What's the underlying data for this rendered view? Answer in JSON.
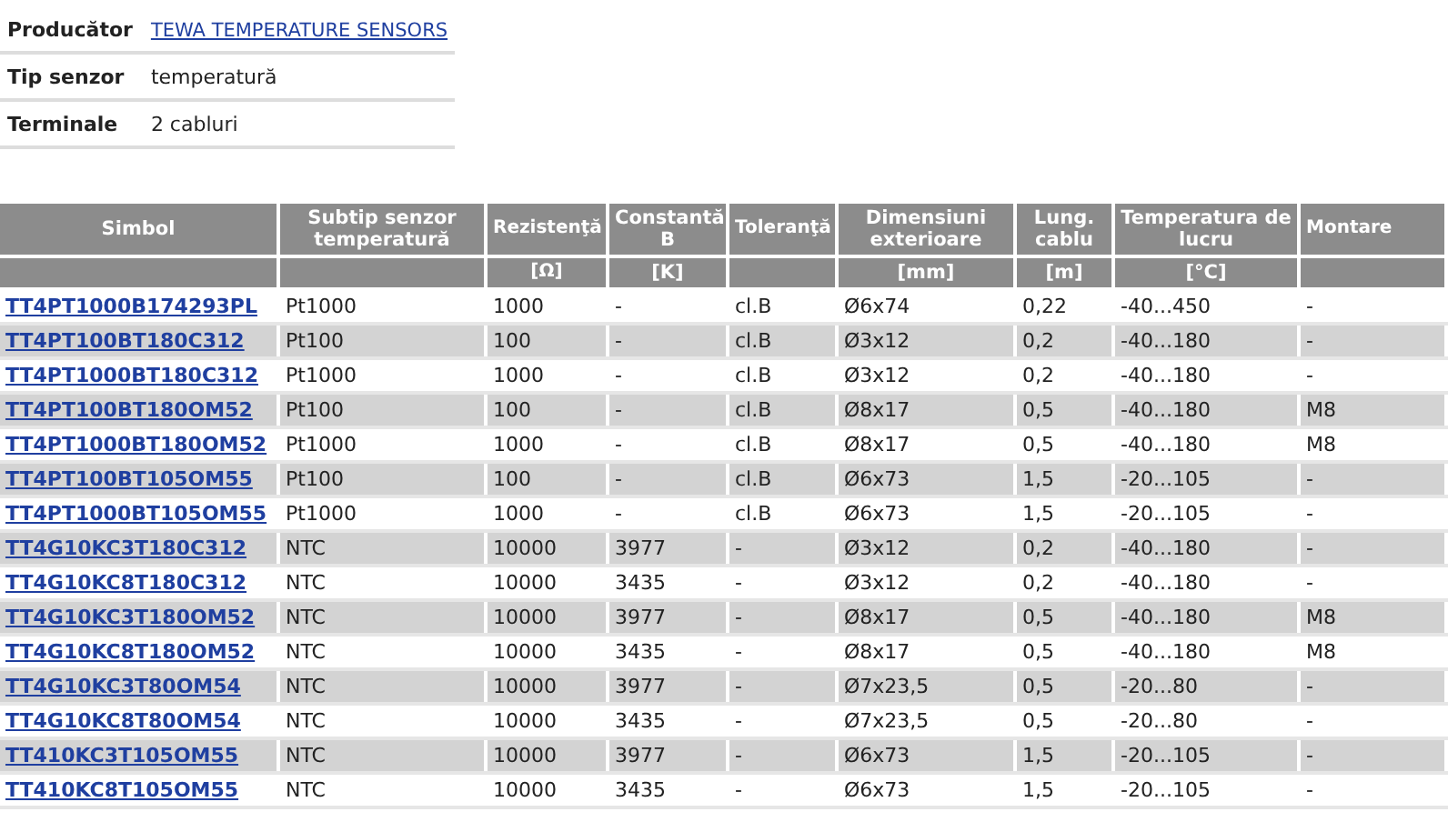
{
  "info": [
    {
      "label": "Producător",
      "value": "TEWA TEMPERATURE SENSORS",
      "kind": "link"
    },
    {
      "label": "Tip senzor",
      "value": "temperatură",
      "kind": "text"
    },
    {
      "label": "Terminale",
      "value": "2 cabluri",
      "kind": "text"
    }
  ],
  "table": {
    "columns": [
      {
        "title": "Simbol"
      },
      {
        "title": "Subtip senzor temperatură"
      },
      {
        "title": "Rezistenţă",
        "unit": "[Ω]"
      },
      {
        "title": "Constantă B",
        "unit": "[K]"
      },
      {
        "title": "Toleranţă"
      },
      {
        "title": "Dimensiuni exterioare",
        "unit": "[mm]"
      },
      {
        "title": "Lung. cablu",
        "unit": "[m]"
      },
      {
        "title": "Temperatura de lucru",
        "unit": "[°C]"
      },
      {
        "title": "Montare"
      }
    ],
    "rows": [
      [
        "TT4PT1000B174293PL",
        "Pt1000",
        "1000",
        "-",
        "cl.B",
        "Ø6x74",
        "0,22",
        "-40...450",
        "-"
      ],
      [
        "TT4PT100BT180C312",
        "Pt100",
        "100",
        "-",
        "cl.B",
        "Ø3x12",
        "0,2",
        "-40...180",
        "-"
      ],
      [
        "TT4PT1000BT180C312",
        "Pt1000",
        "1000",
        "-",
        "cl.B",
        "Ø3x12",
        "0,2",
        "-40...180",
        "-"
      ],
      [
        "TT4PT100BT180OM52",
        "Pt100",
        "100",
        "-",
        "cl.B",
        "Ø8x17",
        "0,5",
        "-40...180",
        "M8"
      ],
      [
        "TT4PT1000BT180OM52",
        "Pt1000",
        "1000",
        "-",
        "cl.B",
        "Ø8x17",
        "0,5",
        "-40...180",
        "M8"
      ],
      [
        "TT4PT100BT105OM55",
        "Pt100",
        "100",
        "-",
        "cl.B",
        "Ø6x73",
        "1,5",
        "-20...105",
        "-"
      ],
      [
        "TT4PT1000BT105OM55",
        "Pt1000",
        "1000",
        "-",
        "cl.B",
        "Ø6x73",
        "1,5",
        "-20...105",
        "-"
      ],
      [
        "TT4G10KC3T180C312",
        "NTC",
        "10000",
        "3977",
        "-",
        "Ø3x12",
        "0,2",
        "-40...180",
        "-"
      ],
      [
        "TT4G10KC8T180C312",
        "NTC",
        "10000",
        "3435",
        "-",
        "Ø3x12",
        "0,2",
        "-40...180",
        "-"
      ],
      [
        "TT4G10KC3T180OM52",
        "NTC",
        "10000",
        "3977",
        "-",
        "Ø8x17",
        "0,5",
        "-40...180",
        "M8"
      ],
      [
        "TT4G10KC8T180OM52",
        "NTC",
        "10000",
        "3435",
        "-",
        "Ø8x17",
        "0,5",
        "-40...180",
        "M8"
      ],
      [
        "TT4G10KC3T80OM54",
        "NTC",
        "10000",
        "3977",
        "-",
        "Ø7x23,5",
        "0,5",
        "-20...80",
        "-"
      ],
      [
        "TT4G10KC8T80OM54",
        "NTC",
        "10000",
        "3435",
        "-",
        "Ø7x23,5",
        "0,5",
        "-20...80",
        "-"
      ],
      [
        "TT410KC3T105OM55",
        "NTC",
        "10000",
        "3977",
        "-",
        "Ø6x73",
        "1,5",
        "-20...105",
        "-"
      ],
      [
        "TT410KC8T105OM55",
        "NTC",
        "10000",
        "3435",
        "-",
        "Ø6x73",
        "1,5",
        "-20...105",
        "-"
      ]
    ]
  }
}
